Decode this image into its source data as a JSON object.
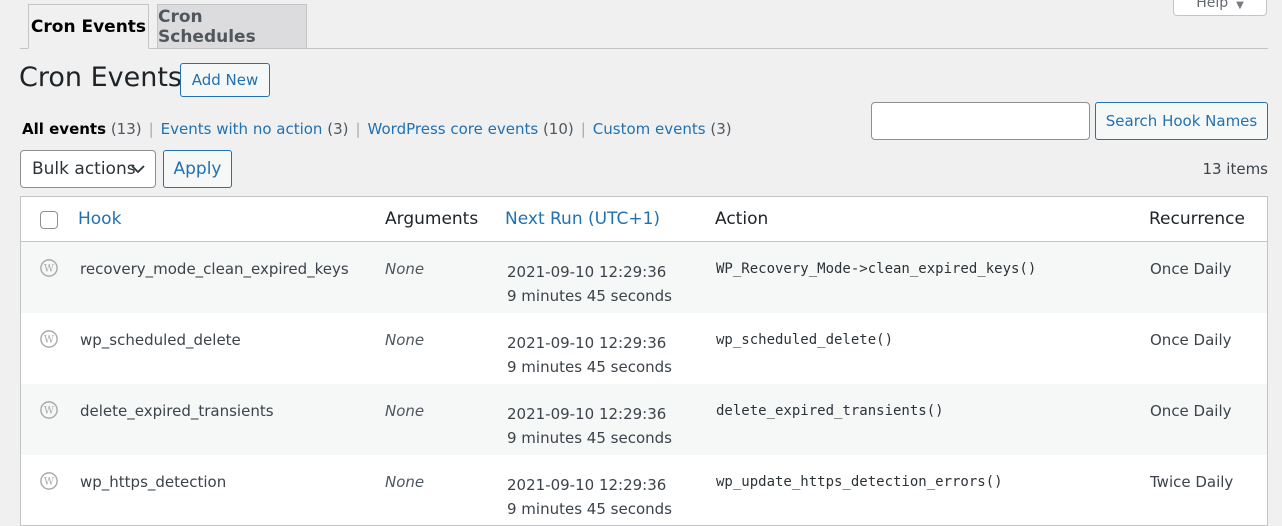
{
  "help": {
    "label": "Help"
  },
  "tabs": [
    {
      "label": "Cron Events"
    },
    {
      "label": "Cron Schedules"
    }
  ],
  "page": {
    "title": "Cron Events",
    "add_new": "Add New"
  },
  "filters": [
    {
      "label": "All events",
      "count": "(13)"
    },
    {
      "label": "Events with no action",
      "count": "(3)"
    },
    {
      "label": "WordPress core events",
      "count": "(10)"
    },
    {
      "label": "Custom events",
      "count": "(3)"
    }
  ],
  "search": {
    "value": "",
    "button": "Search Hook Names"
  },
  "bulk": {
    "selected": "Bulk actions",
    "apply": "Apply"
  },
  "items_count": "13 items",
  "table": {
    "columns": [
      "Hook",
      "Arguments",
      "Next Run (UTC+1)",
      "Action",
      "Recurrence"
    ],
    "rows": [
      {
        "hook": "recovery_mode_clean_expired_keys",
        "args": "None",
        "next_date": "2021-09-10 12:29:36",
        "next_rel": "9 minutes 45 seconds",
        "action": "WP_Recovery_Mode->clean_expired_keys()",
        "recurrence": "Once Daily"
      },
      {
        "hook": "wp_scheduled_delete",
        "args": "None",
        "next_date": "2021-09-10 12:29:36",
        "next_rel": "9 minutes 45 seconds",
        "action": "wp_scheduled_delete()",
        "recurrence": "Once Daily"
      },
      {
        "hook": "delete_expired_transients",
        "args": "None",
        "next_date": "2021-09-10 12:29:36",
        "next_rel": "9 minutes 45 seconds",
        "action": "delete_expired_transients()",
        "recurrence": "Once Daily"
      },
      {
        "hook": "wp_https_detection",
        "args": "None",
        "next_date": "2021-09-10 12:29:36",
        "next_rel": "9 minutes 45 seconds",
        "action": "wp_update_https_detection_errors()",
        "recurrence": "Twice Daily"
      }
    ]
  },
  "colors": {
    "link": "#2271b1",
    "border": "#c3c4c7",
    "background": "#f0f0f1"
  }
}
